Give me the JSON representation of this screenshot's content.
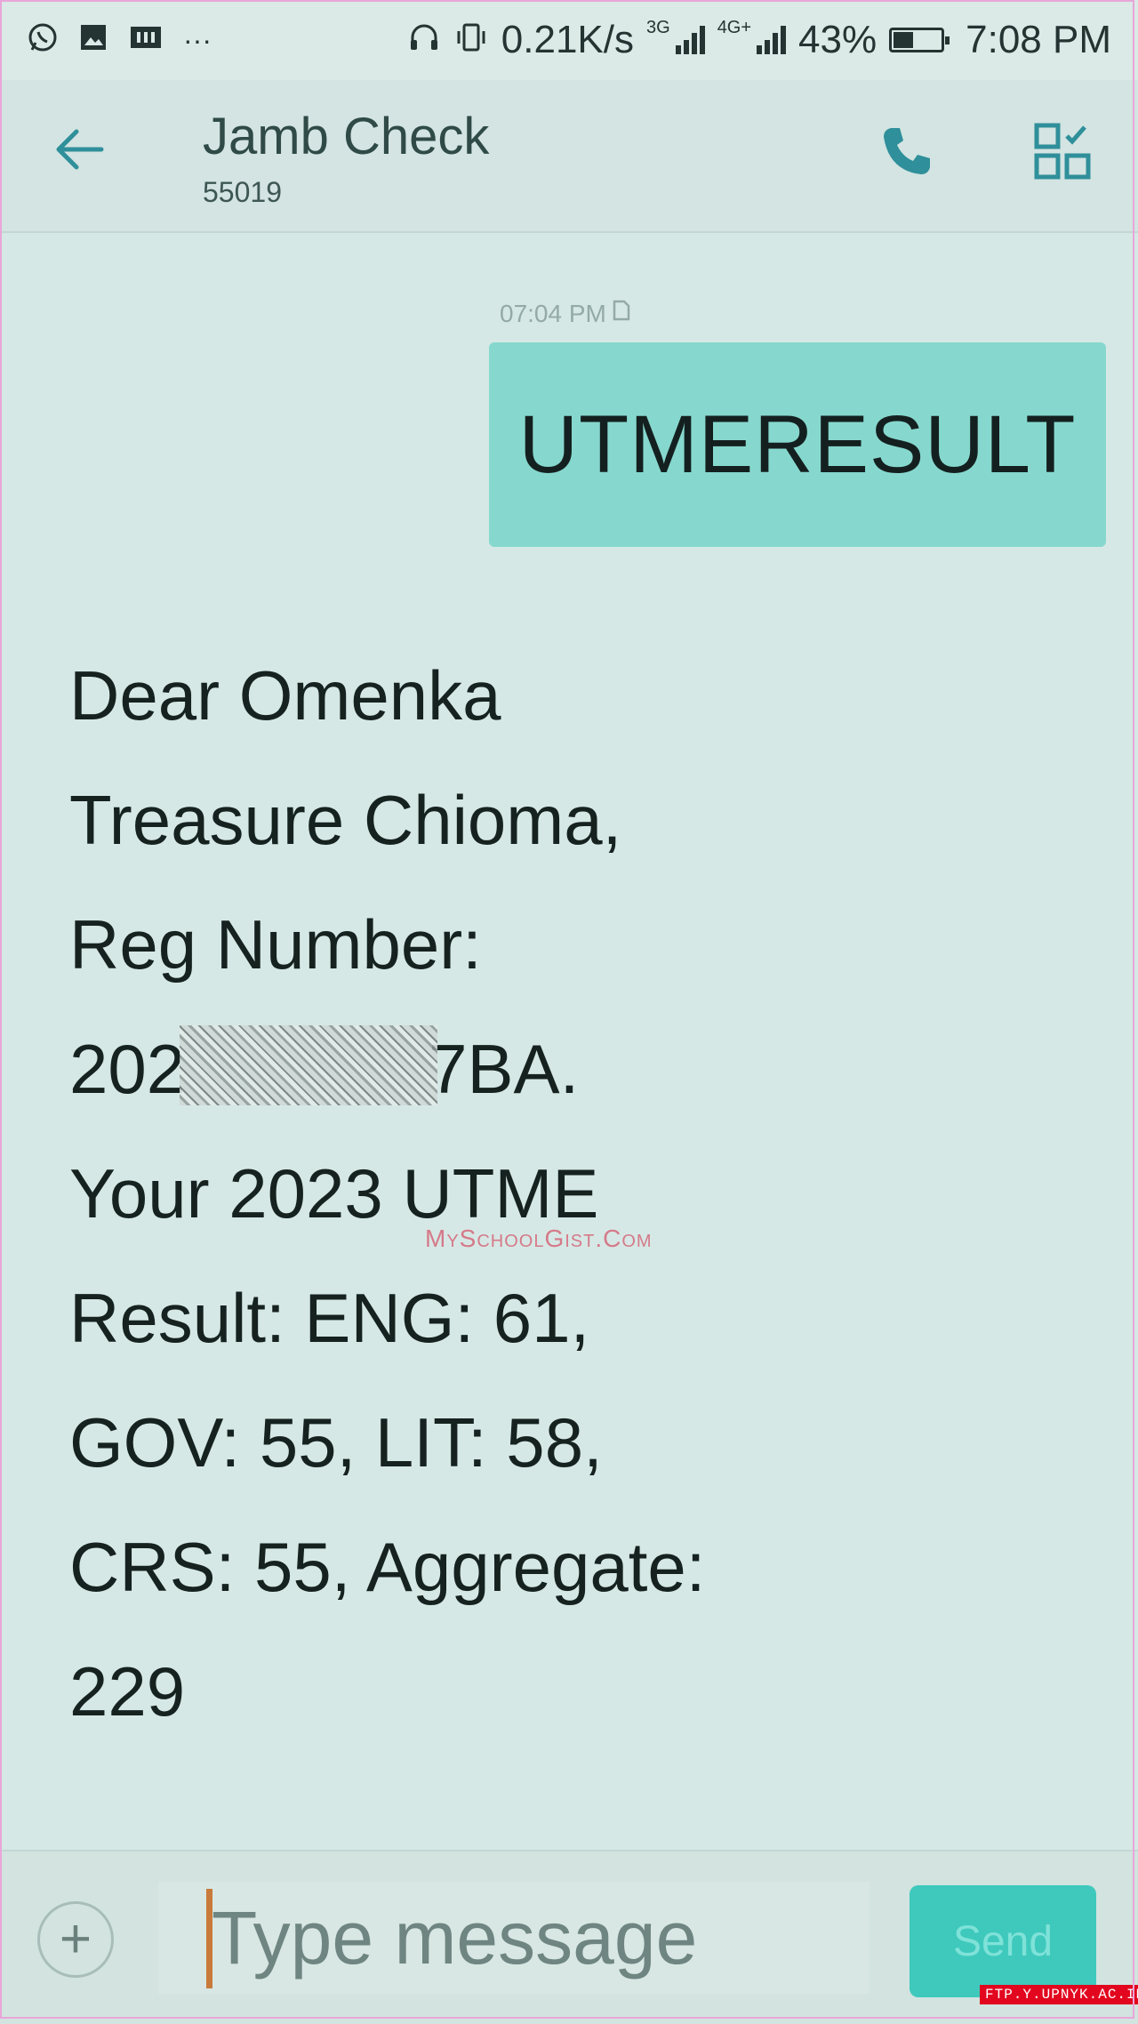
{
  "status_bar": {
    "left_icons": [
      "whatsapp-icon",
      "gallery-icon",
      "ticket-icon",
      "more-notifications-icon"
    ],
    "more_label": "···",
    "net_speed": "0.21K/s",
    "sim1_type": "3G",
    "sim2_type": "4G+",
    "battery_percent": "43%",
    "battery_level": 0.43,
    "time": "7:08 PM"
  },
  "header": {
    "contact_name": "Jamb Check",
    "contact_number": "55019",
    "icons": [
      "back-arrow-icon",
      "phone-icon",
      "grid-menu-icon"
    ]
  },
  "conversation": {
    "sent": {
      "timestamp": "07:04 PM",
      "text": "UTMERESULT"
    },
    "received": {
      "lines": [
        "Dear Omenka",
        "Treasure Chioma,",
        "Reg Number:",
        "Your 2023 UTME",
        "Result: ENG: 61,",
        "GOV: 55, LIT: 58,",
        "CRS: 55, Aggregate:",
        "229"
      ],
      "reg_number_visible_start": "202",
      "reg_number_visible_end": "7BA."
    },
    "watermark": "MySchoolGist.Com"
  },
  "compose": {
    "placeholder": "Type message",
    "send_label": "Send"
  },
  "corner_tag": "FTP.Y.UPNYK.AC.ID",
  "colors": {
    "background": "#d6e8e5",
    "sent_bubble": "#86d8ce",
    "send_button": "#3fc9bd",
    "accent": "#2f8f9a"
  }
}
